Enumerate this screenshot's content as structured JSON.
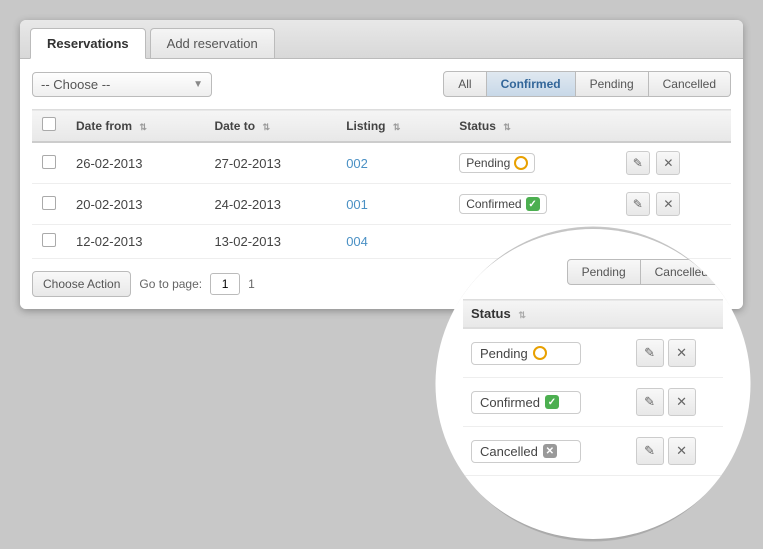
{
  "tabs": [
    {
      "id": "reservations",
      "label": "Reservations",
      "active": true
    },
    {
      "id": "add-reservation",
      "label": "Add reservation",
      "active": false
    }
  ],
  "filter": {
    "dropdown": {
      "placeholder": "-- Choose --"
    },
    "buttons": [
      {
        "id": "all",
        "label": "All",
        "active": false
      },
      {
        "id": "confirmed",
        "label": "Confirmed",
        "active": true
      },
      {
        "id": "pending",
        "label": "Pending",
        "active": false
      },
      {
        "id": "cancelled",
        "label": "Cancelled",
        "active": false
      }
    ]
  },
  "table": {
    "columns": [
      {
        "id": "date-from",
        "label": "Date from"
      },
      {
        "id": "date-to",
        "label": "Date to"
      },
      {
        "id": "listing",
        "label": "Listing"
      },
      {
        "id": "status",
        "label": "Status"
      }
    ],
    "rows": [
      {
        "date_from": "26-02-2013",
        "date_to": "27-02-2013",
        "listing": "002",
        "status": "Pending",
        "status_type": "pending"
      },
      {
        "date_from": "20-02-2013",
        "date_to": "24-02-2013",
        "listing": "001",
        "status": "Confirmed",
        "status_type": "confirmed"
      },
      {
        "date_from": "12-02-2013",
        "date_to": "13-02-2013",
        "listing": "004",
        "status": "",
        "status_type": "none"
      }
    ]
  },
  "pagination": {
    "action_button_label": "Choose Action",
    "goto_label": "Go to page:",
    "current_page": "1",
    "total_pages": "1"
  },
  "magnified": {
    "filter_buttons": [
      {
        "label": "Pending",
        "active": false
      },
      {
        "label": "Cancelled",
        "active": false
      }
    ],
    "table_header": "Status",
    "rows": [
      {
        "label": "Pending",
        "type": "pending"
      },
      {
        "label": "Confirmed",
        "type": "confirmed"
      },
      {
        "label": "Cancelled",
        "type": "cancelled"
      }
    ]
  },
  "icons": {
    "edit": "✎",
    "close": "✕",
    "check": "✓",
    "sort": "⇅",
    "dropdown_arrow": "▼"
  }
}
